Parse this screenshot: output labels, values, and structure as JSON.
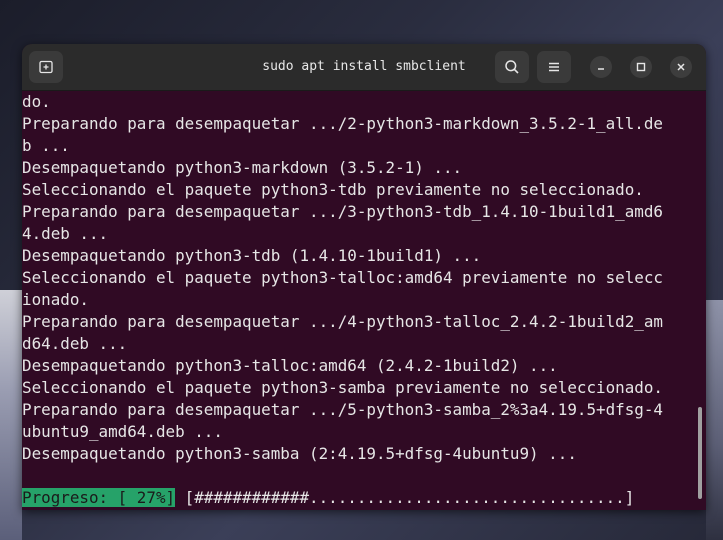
{
  "window": {
    "title": "sudo apt install smbclient"
  },
  "icons": {
    "new_tab": "new-tab-icon",
    "search": "search-icon",
    "menu": "hamburger-menu-icon",
    "minimize": "minimize-icon",
    "maximize": "maximize-icon",
    "close": "close-icon"
  },
  "colors": {
    "terminal_background": "#300a24",
    "progress_highlight": "#26a269",
    "titlebar": "#2b2b2b"
  },
  "terminal": {
    "lines": [
      "do.",
      "Preparando para desempaquetar .../2-python3-markdown_3.5.2-1_all.de",
      "b ...",
      "Desempaquetando python3-markdown (3.5.2-1) ...",
      "Seleccionando el paquete python3-tdb previamente no seleccionado.",
      "Preparando para desempaquetar .../3-python3-tdb_1.4.10-1build1_amd6",
      "4.deb ...",
      "Desempaquetando python3-tdb (1.4.10-1build1) ...",
      "Seleccionando el paquete python3-talloc:amd64 previamente no selecc",
      "ionado.",
      "Preparando para desempaquetar .../4-python3-talloc_2.4.2-1build2_am",
      "d64.deb ...",
      "Desempaquetando python3-talloc:amd64 (2.4.2-1build2) ...",
      "Seleccionando el paquete python3-samba previamente no seleccionado.",
      "Preparando para desempaquetar .../5-python3-samba_2%3a4.19.5+dfsg-4",
      "ubuntu9_amd64.deb ...",
      "Desempaquetando python3-samba (2:4.19.5+dfsg-4ubuntu9) ..."
    ],
    "progress_label": "Progreso: [ 27%]",
    "progress_bar": " [############.................................]",
    "progress_percent": 27
  }
}
